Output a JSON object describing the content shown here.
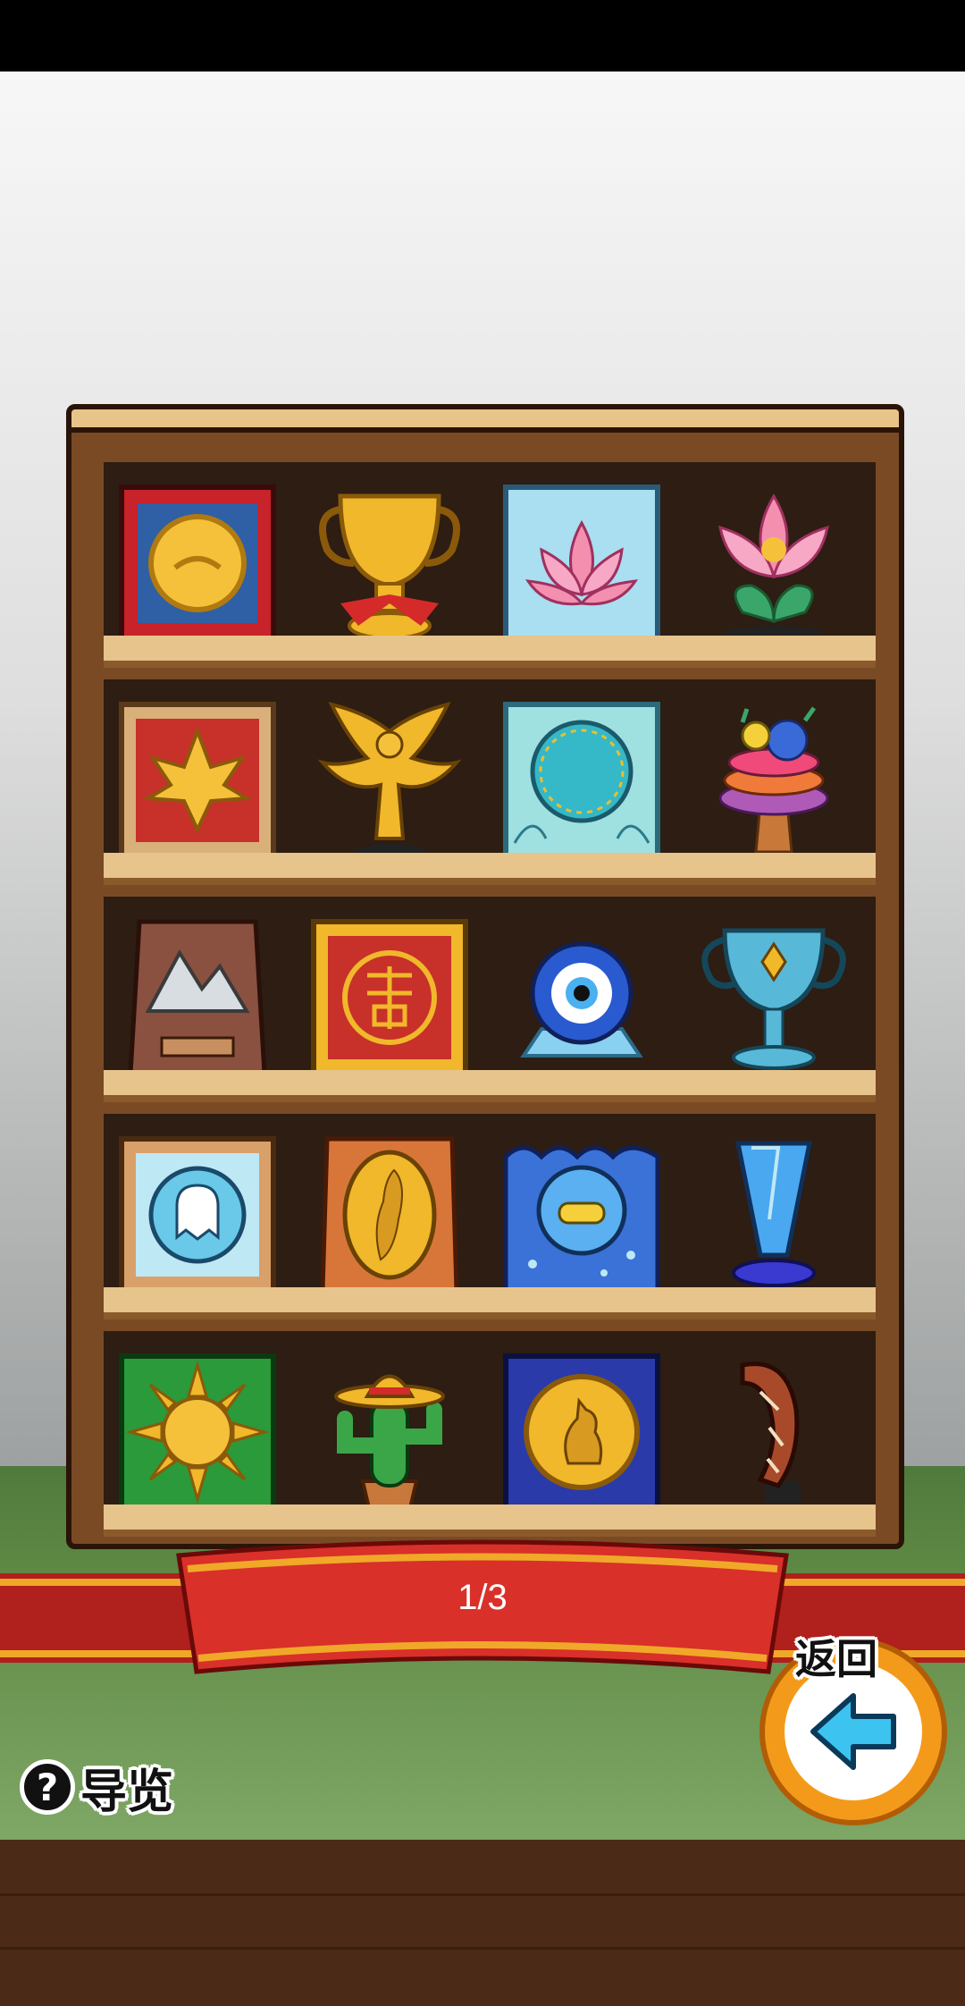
{
  "page": {
    "indicator": "1/3"
  },
  "guide": {
    "label": "导览",
    "icon": "question-icon"
  },
  "back": {
    "label": "返回",
    "icon": "arrow-left-icon"
  },
  "shelf": {
    "rows": [
      [
        "framed-coin",
        "gold-cup",
        "lotus-plaque",
        "lotus-flower"
      ],
      [
        "maple-leaf-plaque",
        "golden-phoenix",
        "teal-mirror-plaque",
        "coral-trophy"
      ],
      [
        "mountain-plaque",
        "double-happiness-plaque",
        "evil-eye-stand",
        "blue-trophy-cup"
      ],
      [
        "framed-ghost-medal",
        "madagascar-plaque",
        "ocean-sub-plaque",
        "nff-glass-trophy"
      ],
      [
        "sun-plaque",
        "sombrero-cactus",
        "kangaroo-coin-plaque",
        "boomerang"
      ]
    ]
  },
  "colors": {
    "ribbon": "#d9302a",
    "ribbon_stripe": "#f0a828",
    "button": "#f49a1b",
    "arrow": "#3cc3f0"
  }
}
